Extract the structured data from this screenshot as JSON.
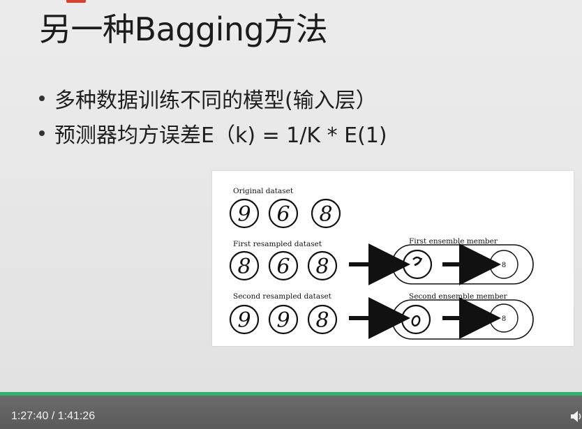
{
  "slide": {
    "title": "另一种Bagging方法",
    "bullets": [
      "多种数据训练不同的模型(输入层）",
      "预测器均方误差E（k) = 1/K * E(1)"
    ]
  },
  "figure": {
    "original_label": "Original dataset",
    "original_digits": [
      "9",
      "6",
      "8"
    ],
    "first_resampled_label": "First resampled dataset",
    "first_resampled_digits": [
      "8",
      "6",
      "8"
    ],
    "first_member_label": "First ensemble member",
    "first_member_output": "8",
    "second_resampled_label": "Second resampled dataset",
    "second_resampled_digits": [
      "9",
      "9",
      "8"
    ],
    "second_member_label": "Second ensemble member",
    "second_member_output": "8"
  },
  "player": {
    "time": "1:27:40 / 1:41:26",
    "accent_color": "#2fb26a",
    "volume_icon": "volume-icon"
  }
}
